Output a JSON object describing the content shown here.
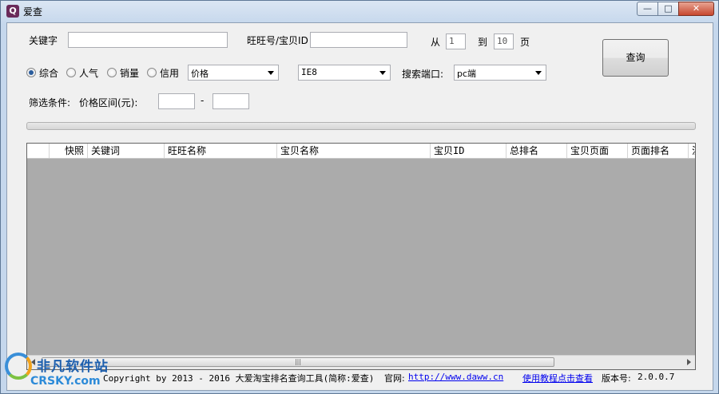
{
  "window": {
    "title": "爱查",
    "icon_glyph": "Q",
    "controls": {
      "minimize": "—",
      "maximize": "□",
      "close": "✕"
    }
  },
  "form": {
    "keyword_label": "关键字",
    "keyword_value": "",
    "wangwang_label": "旺旺号/宝贝ID",
    "wangwang_value": "",
    "from_label": "从",
    "from_value": "1",
    "to_label": "到",
    "to_value": "10",
    "page_label": "页",
    "sort_options": [
      {
        "label": "综合",
        "checked": true
      },
      {
        "label": "人气",
        "checked": false
      },
      {
        "label": "销量",
        "checked": false
      },
      {
        "label": "信用",
        "checked": false
      }
    ],
    "price_combo": "价格",
    "browser_combo": "IE8",
    "port_label": "搜索端口:",
    "port_combo": "pc端",
    "filter_label": "筛选条件:",
    "price_range_label": "价格区间(元):",
    "price_min": "",
    "price_dash": "-",
    "price_max": ""
  },
  "query_button": "查询",
  "progress": 0,
  "table": {
    "columns": [
      "快照",
      "关键词",
      "旺旺名称",
      "宝贝名称",
      "宝贝ID",
      "总排名",
      "宝贝页面",
      "页面排名",
      "注"
    ],
    "rows": []
  },
  "footer": {
    "copyright": "Copyright by 2013 - 2016 大爱淘宝排名查询工具(简称:爱查)",
    "site_label": "官网:",
    "site_link": "http://www.daww.cn",
    "tutorial_link": "使用教程点击查看",
    "version_label": "版本号:",
    "version_value": "2.0.0.7"
  },
  "watermark": {
    "line1": "非凡软件站",
    "line2": "CRSKY.com"
  },
  "colors": {
    "grid_background": "#ababab",
    "link": "#0000ee",
    "close_button": "#c7472e"
  }
}
